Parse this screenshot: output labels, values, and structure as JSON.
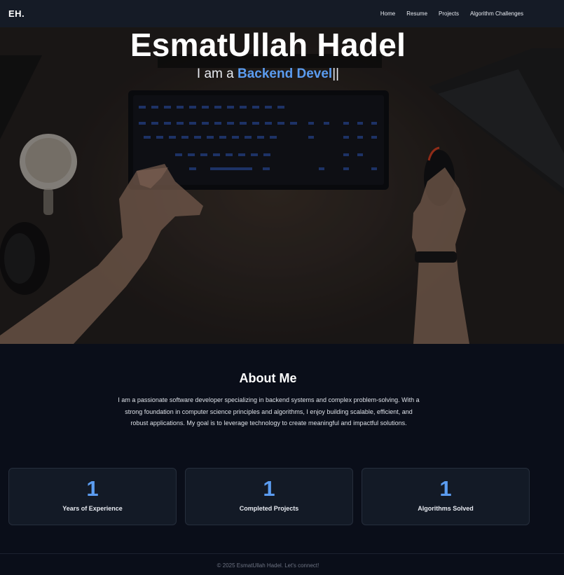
{
  "nav": {
    "logo": "EH.",
    "links": [
      "Home",
      "Resume",
      "Projects",
      "Algorithm Challenges"
    ]
  },
  "hero": {
    "title": "EsmatUllah Hadel",
    "subtitle_prefix": "I am a ",
    "subtitle_typed": "Backend Devel",
    "cursor": "||"
  },
  "about": {
    "title": "About Me",
    "text": "I am a passionate software developer specializing in backend systems and complex problem-solving. With a strong foundation in computer science principles and algorithms, I enjoy building scalable, efficient, and robust applications. My goal is to leverage technology to create meaningful and impactful solutions."
  },
  "stats": [
    {
      "value": "1",
      "label": "Years of Experience"
    },
    {
      "value": "1",
      "label": "Completed Projects"
    },
    {
      "value": "1",
      "label": "Algorithms Solved"
    }
  ],
  "footer": {
    "text": "© 2025 EsmatUllah Hadel. Let's connect!"
  },
  "colors": {
    "accent": "#5b9cf0",
    "background": "#0a0e19",
    "navbar": "#151b26",
    "card": "#131a26"
  }
}
